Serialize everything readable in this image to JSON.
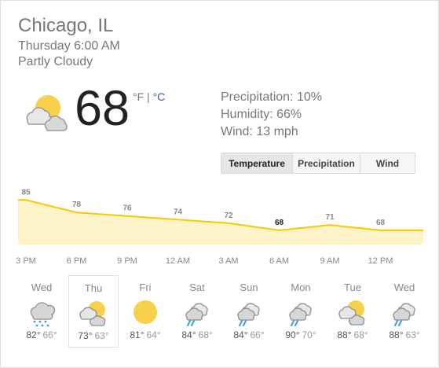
{
  "location": "Chicago, IL",
  "datetime": "Thursday 6:00 AM",
  "condition": "Partly Cloudy",
  "current": {
    "temperature": "68",
    "unit_f": "°F",
    "unit_sep": " | ",
    "unit_c": "°C",
    "icon": "partly-cloudy-icon"
  },
  "stats": {
    "precipitation": "Precipitation: 10%",
    "humidity": "Humidity: 66%",
    "wind": "Wind: 13 mph"
  },
  "tabs": [
    {
      "label": "Temperature",
      "active": true
    },
    {
      "label": "Precipitation",
      "active": false
    },
    {
      "label": "Wind",
      "active": false
    }
  ],
  "chart_data": {
    "type": "area",
    "categories": [
      "3 PM",
      "6 PM",
      "9 PM",
      "12 AM",
      "3 AM",
      "6 AM",
      "9 AM",
      "12 PM"
    ],
    "values": [
      85,
      78,
      76,
      74,
      72,
      68,
      71,
      68
    ],
    "highlight_index": 5,
    "ylim": [
      60,
      90
    ],
    "colors": {
      "line": "#f7c900",
      "fill": "#fdf3c9"
    }
  },
  "forecast": [
    {
      "day": "Wed",
      "icon": "rain-cloud-icon",
      "hi": "82°",
      "lo": "66°"
    },
    {
      "day": "Thu",
      "icon": "partly-cloudy-icon",
      "hi": "73°",
      "lo": "63°",
      "selected": true
    },
    {
      "day": "Fri",
      "icon": "sun-icon",
      "hi": "81°",
      "lo": "64°"
    },
    {
      "day": "Sat",
      "icon": "thunderstorm-icon",
      "hi": "84°",
      "lo": "68°"
    },
    {
      "day": "Sun",
      "icon": "thunderstorm-icon",
      "hi": "84°",
      "lo": "66°"
    },
    {
      "day": "Mon",
      "icon": "thunderstorm-icon",
      "hi": "90°",
      "lo": "70°"
    },
    {
      "day": "Tue",
      "icon": "partly-cloudy-icon",
      "hi": "88°",
      "lo": "68°"
    },
    {
      "day": "Wed",
      "icon": "thunderstorm-icon",
      "hi": "88°",
      "lo": "63°"
    }
  ]
}
